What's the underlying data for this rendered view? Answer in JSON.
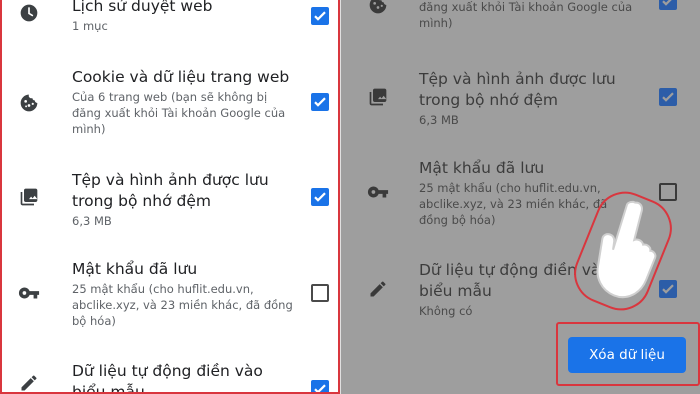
{
  "left_panel": {
    "items": [
      {
        "title": "Lịch sử duyệt web",
        "sub": "1 mục",
        "checked": true,
        "icon": "clock-icon"
      },
      {
        "title": "Cookie và dữ liệu trang web",
        "sub": "Của 6 trang web (bạn sẽ không bị đăng xuất khỏi Tài khoản Google của mình)",
        "checked": true,
        "icon": "cookie-icon"
      },
      {
        "title": "Tệp và hình ảnh được lưu trong bộ nhớ đệm",
        "sub": "6,3 MB",
        "checked": true,
        "icon": "image-icon"
      },
      {
        "title": "Mật khẩu đã lưu",
        "sub": "25 mật khẩu (cho huflit.edu.vn, abclike.xyz, và 23 miền khác, đã đồng bộ hóa)",
        "checked": false,
        "icon": "key-icon"
      },
      {
        "title": "Dữ liệu tự động điền vào biểu mẫu",
        "sub": "",
        "checked": true,
        "icon": "pencil-icon"
      }
    ]
  },
  "right_panel": {
    "items": [
      {
        "title": "",
        "sub": "đăng xuất khỏi Tài khoản Google của mình)",
        "checked": true,
        "icon": "cookie-icon"
      },
      {
        "title": "Tệp và hình ảnh được lưu trong bộ nhớ đệm",
        "sub": "6,3 MB",
        "checked": true,
        "icon": "image-icon"
      },
      {
        "title": "Mật khẩu đã lưu",
        "sub": "25 mật khẩu (cho huflit.edu.vn, abclike.xyz, và 23 miền khác, đã đồng bộ hóa)",
        "checked": false,
        "icon": "key-icon"
      },
      {
        "title": "Dữ liệu tự động điền vào biểu mẫu",
        "sub": "Không có",
        "checked": true,
        "icon": "pencil-icon"
      }
    ],
    "clear_button": "Xóa dữ liệu"
  },
  "colors": {
    "accent": "#1a73e8",
    "highlight": "#d9363e",
    "dim_overlay": "#9e9e9e"
  }
}
